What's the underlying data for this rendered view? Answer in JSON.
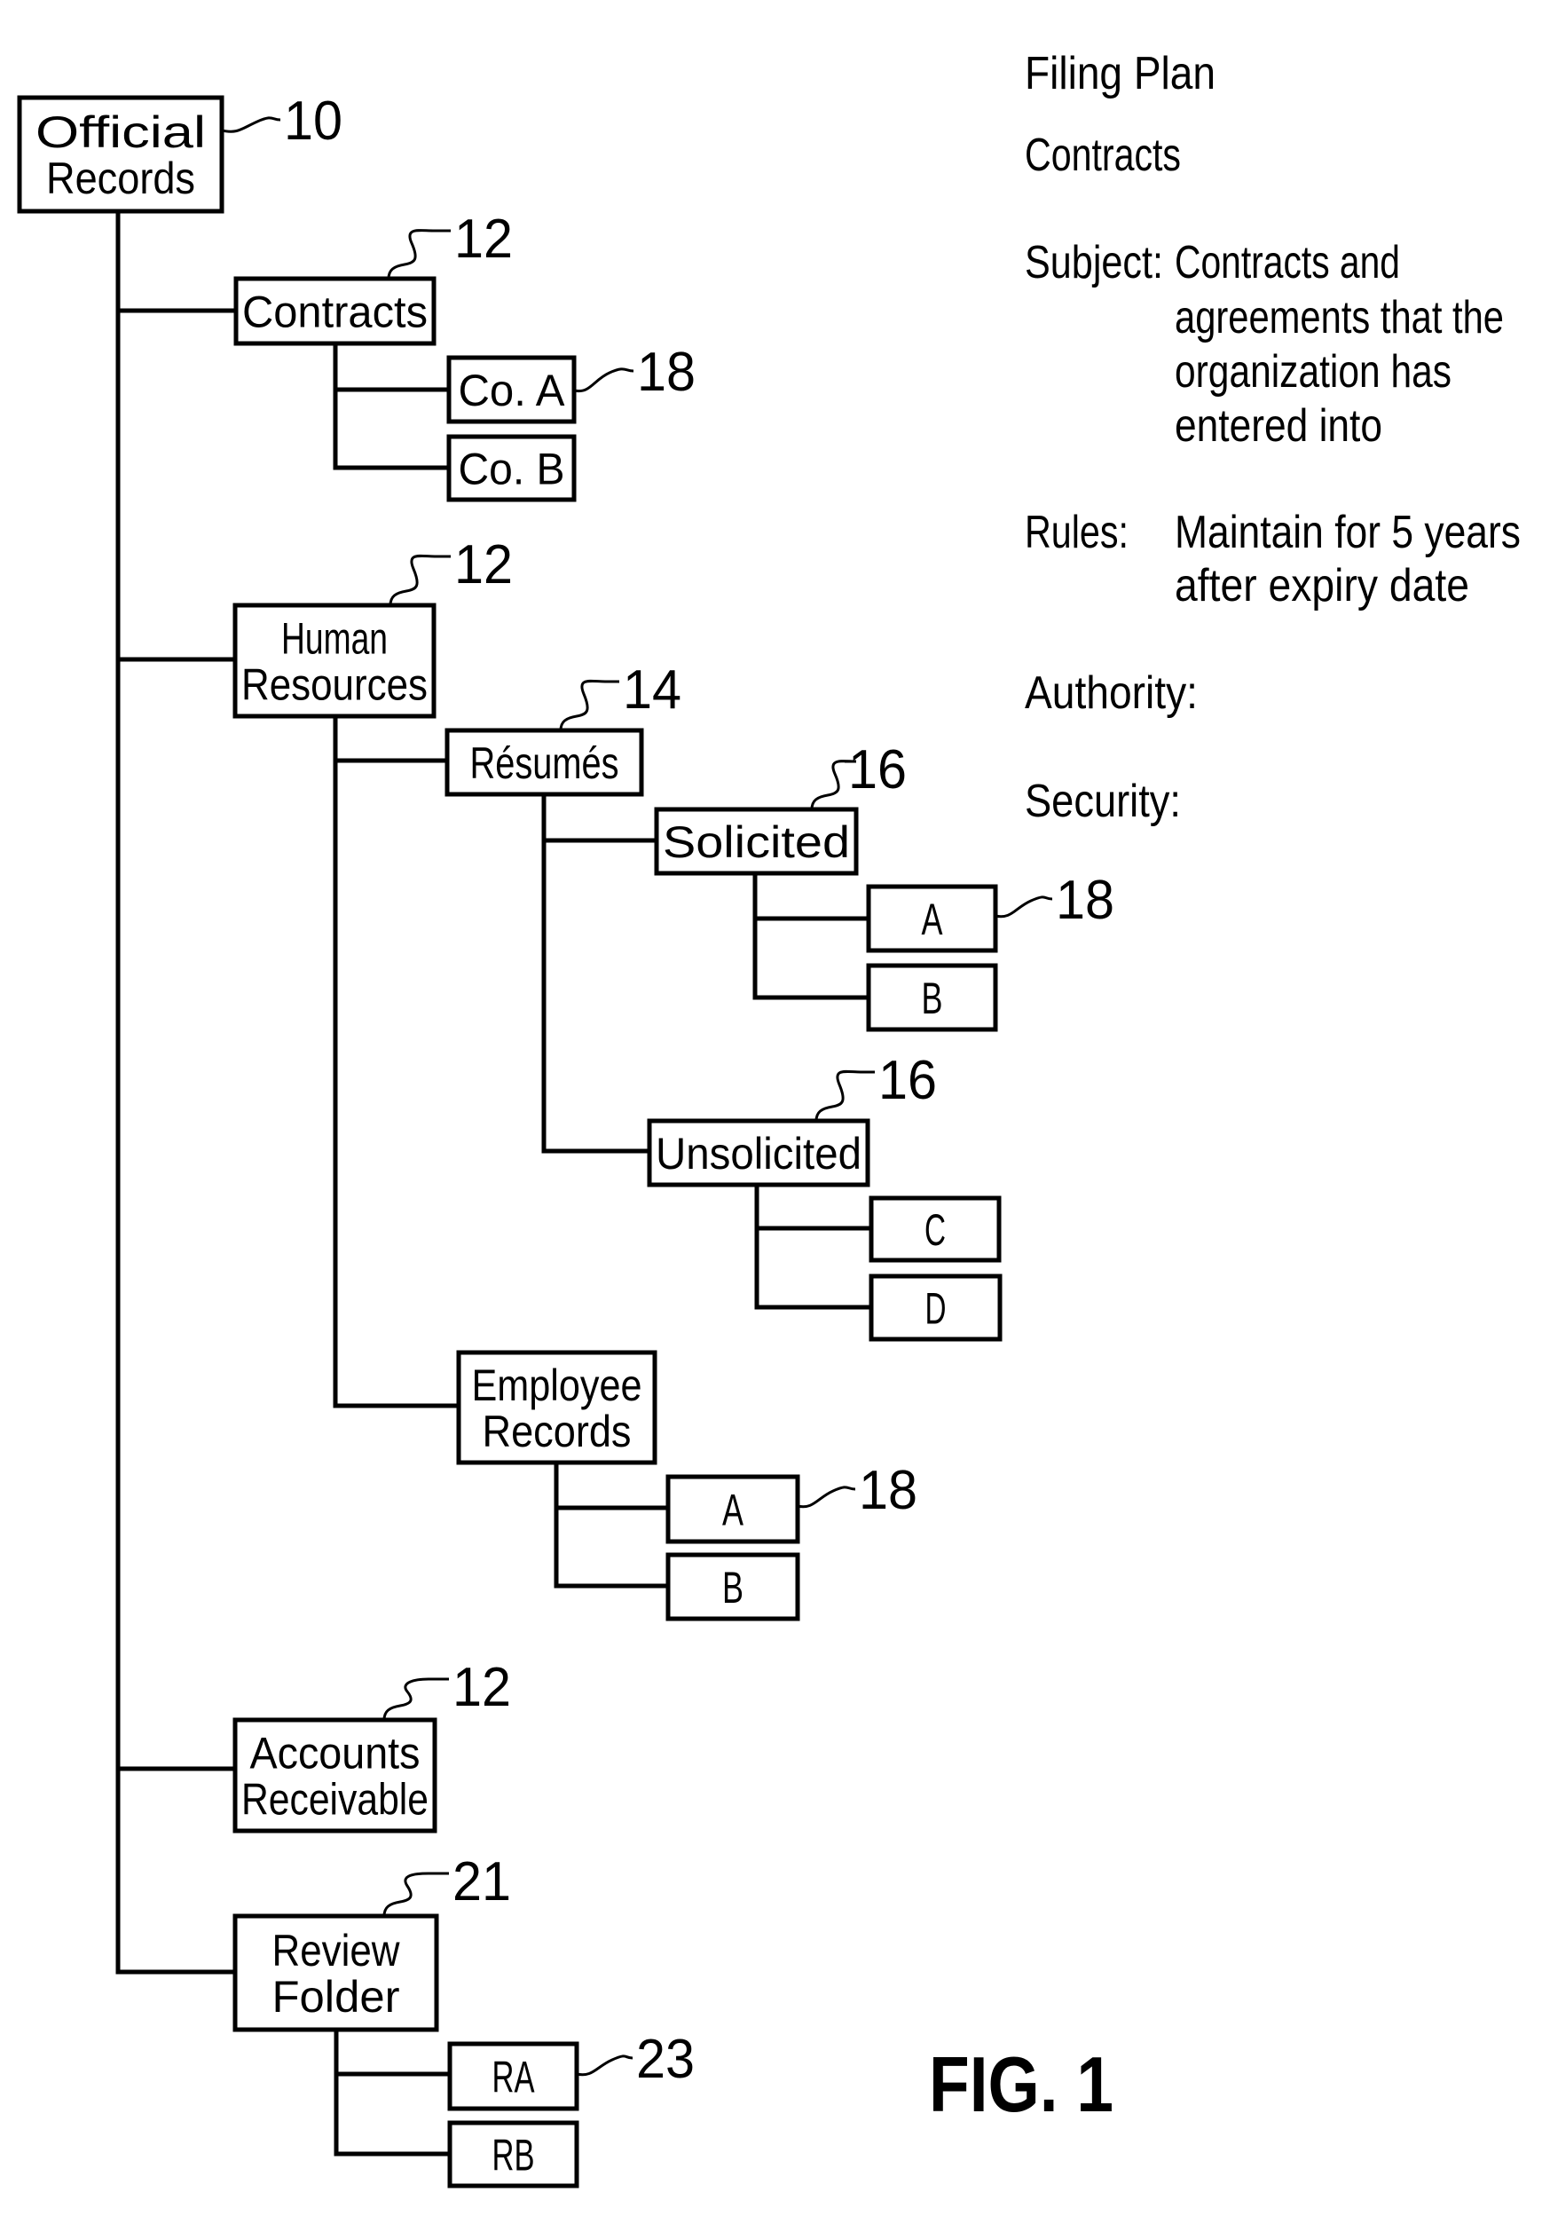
{
  "tree": {
    "root": {
      "label": [
        "Official",
        "Records"
      ],
      "ref": "10"
    },
    "nodes": {
      "contracts": {
        "label": [
          "Contracts"
        ],
        "ref": "12"
      },
      "co_a": {
        "label": [
          "Co. A"
        ],
        "ref": "18"
      },
      "co_b": {
        "label": [
          "Co. B"
        ]
      },
      "human_resources": {
        "label": [
          "Human",
          "Resources"
        ],
        "ref": "12"
      },
      "resumes": {
        "label": [
          "Résumés"
        ],
        "ref": "14"
      },
      "solicited": {
        "label": [
          "Solicited"
        ],
        "ref": "16"
      },
      "solicited_a": {
        "label": [
          "A"
        ],
        "ref": "18"
      },
      "solicited_b": {
        "label": [
          "B"
        ]
      },
      "unsolicited": {
        "label": [
          "Unsolicited"
        ],
        "ref": "16"
      },
      "unsolicited_c": {
        "label": [
          "C"
        ]
      },
      "unsolicited_d": {
        "label": [
          "D"
        ]
      },
      "employee_records": {
        "label": [
          "Employee",
          "Records"
        ]
      },
      "employee_a": {
        "label": [
          "A"
        ],
        "ref": "18"
      },
      "employee_b": {
        "label": [
          "B"
        ]
      },
      "accounts_receivable": {
        "label": [
          "Accounts",
          "Receivable"
        ],
        "ref": "12"
      },
      "review_folder": {
        "label": [
          "Review",
          "Folder"
        ],
        "ref": "21"
      },
      "review_ra": {
        "label": [
          "RA"
        ],
        "ref": "23"
      },
      "review_rb": {
        "label": [
          "RB"
        ]
      }
    }
  },
  "filing_plan": {
    "title": "Filing Plan",
    "subtitle": "Contracts",
    "fields": [
      {
        "key": "Subject:",
        "value_lines": [
          "Contracts and",
          "agreements that the",
          "organization has",
          "entered into"
        ]
      },
      {
        "key": "Rules:",
        "value_lines": [
          "Maintain for 5 years",
          "after expiry date"
        ]
      },
      {
        "key": "Authority:",
        "value_lines": []
      },
      {
        "key": "Security:",
        "value_lines": []
      }
    ]
  },
  "figure_label": "FIG. 1"
}
